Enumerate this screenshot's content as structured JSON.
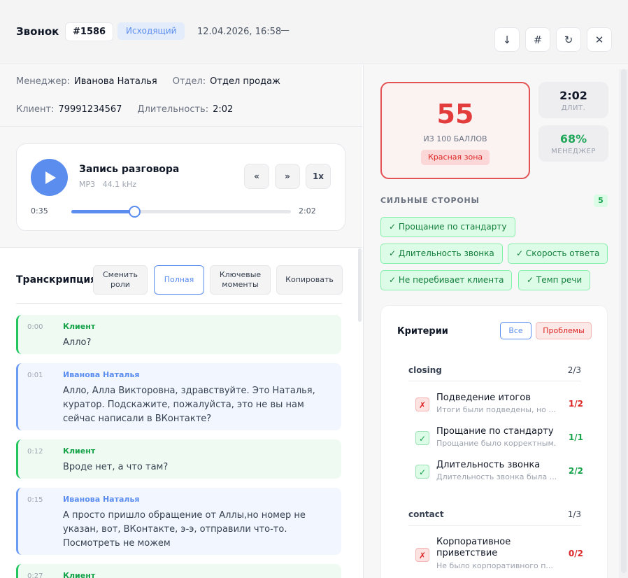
{
  "header": {
    "title": "Звонок",
    "call_id": "#1586",
    "call_type": "Исходящий",
    "datetime": "12.04.2026, 16:58",
    "dash": "—",
    "actions": [
      {
        "icon": "download-icon",
        "glyph": "↓"
      },
      {
        "icon": "hash-icon",
        "glyph": "#"
      },
      {
        "icon": "refresh-icon",
        "glyph": "↻"
      },
      {
        "icon": "close-icon",
        "glyph": "✕"
      }
    ]
  },
  "info": {
    "manager_label": "Менеджер:",
    "manager_value": "Иванова Наталья",
    "department_label": "Отдел:",
    "department_value": "Отдел продаж",
    "client_label": "Клиент:",
    "client_value": "79991234567",
    "duration_label": "Длительность:",
    "duration_value": "2:02"
  },
  "player": {
    "title": "Запись разговора",
    "format": "MP3",
    "rate": "44.1 kHz",
    "rewind_label": "«",
    "forward_label": "»",
    "speed_label": "1x",
    "current_time": "0:35",
    "total_time": "2:02",
    "progress": 0.287
  },
  "transcript": {
    "title": "Транскрипция",
    "buttons": [
      "Сменить роли",
      "Полная",
      "Ключевые моменты",
      "Копировать"
    ],
    "messages": [
      {
        "role": "client",
        "time": "0:00",
        "speaker": "Клиент",
        "text": "Алло?"
      },
      {
        "role": "mgr",
        "time": "0:01",
        "speaker": "Иванова Наталья",
        "text": "Алло, Алла Викторовна, здравствуйте. Это Наталья, куратор. Подскажите, пожалуйста, это не вы нам сейчас написали в ВКонтакте?"
      },
      {
        "role": "client",
        "time": "0:12",
        "speaker": "Клиент",
        "text": "Вроде нет, а что там?"
      },
      {
        "role": "mgr",
        "time": "0:15",
        "speaker": "Иванова Наталья",
        "text": "А просто пришло обращение от Аллы,но номер не указан, вот, ВКонтакте, э-э, отправили что-то. Посмотреть не можем"
      },
      {
        "role": "client",
        "time": "0:27",
        "speaker": "Клиент",
        "text": ""
      }
    ]
  },
  "score": {
    "value": "55",
    "subtitle": "ИЗ 100 БАЛЛОВ",
    "zone": "Красная зона",
    "duration_value": "2:02",
    "duration_label": "ДЛИТ.",
    "manager_value": "68%",
    "manager_label": "МЕНЕДЖЕР",
    "colors": {
      "red": "#e23c3c",
      "green": "#16a34a"
    }
  },
  "strengths": {
    "title": "СИЛЬНЫЕ СТОРОНЫ",
    "count": "5",
    "tags": [
      "✓ Прощание по стандарту",
      "✓ Длительность звонка",
      "✓ Скорость ответа",
      "✓ Не перебивает клиента",
      "✓ Темп речи"
    ]
  },
  "criteria": {
    "title": "Критерии",
    "filter_all": "Все",
    "filter_problems": "Проблемы",
    "groups": [
      {
        "name": "closing",
        "count": "2/3",
        "items": [
          {
            "status": "bad",
            "mark": "✗",
            "title": "Подведение итогов",
            "desc": "Итоги были подведены, но ...",
            "score": "1/2"
          },
          {
            "status": "good",
            "mark": "✓",
            "title": "Прощание по стандарту",
            "desc": "Прощание было корректным.",
            "score": "1/1"
          },
          {
            "status": "good",
            "mark": "✓",
            "title": "Длительность звонка",
            "desc": "Длительность звонка была ...",
            "score": "2/2"
          }
        ]
      },
      {
        "name": "contact",
        "count": "1/3",
        "items": [
          {
            "status": "bad",
            "mark": "✗",
            "title_lines": [
              "Корпоративное",
              "приветствие"
            ],
            "desc": "Не было корпоративного п...",
            "score": "0/2"
          }
        ]
      }
    ]
  }
}
